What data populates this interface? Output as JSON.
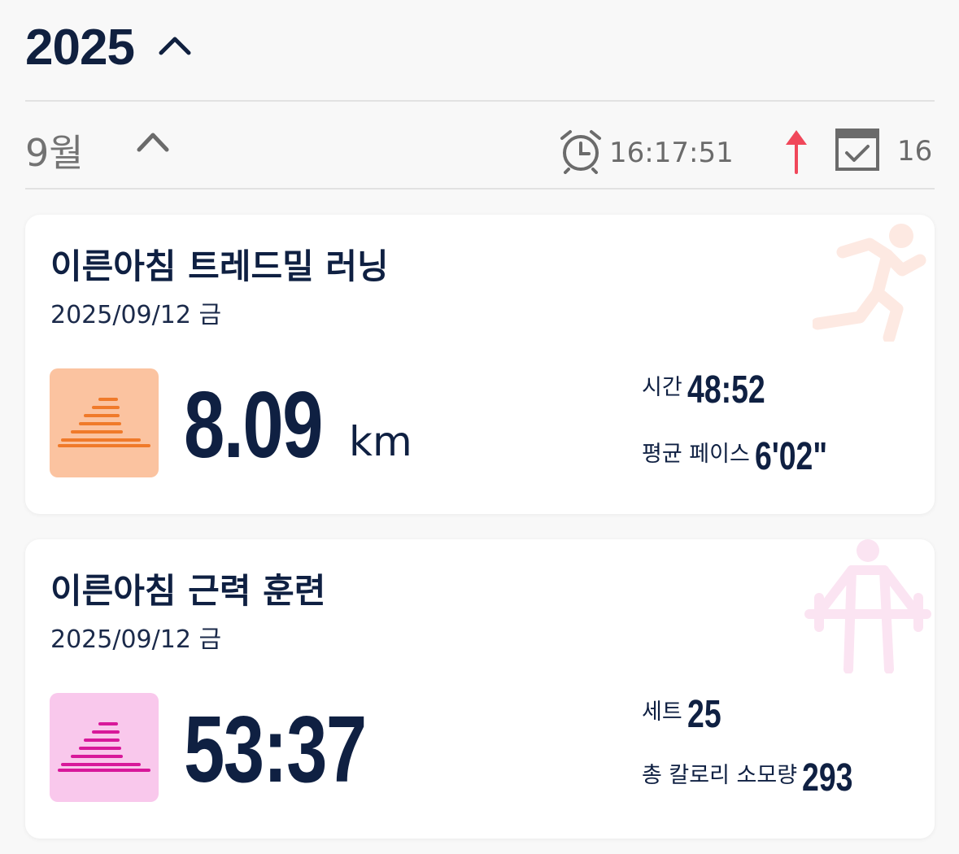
{
  "year": {
    "label": "2025"
  },
  "month": {
    "label": "9월",
    "time_total": "16:17:51",
    "days": "16",
    "colors": {
      "trend_up": "#f0475a",
      "icon_gray": "#6b6b6b"
    }
  },
  "activities": [
    {
      "title": "이른아침 트레드밀 러닝",
      "date": "2025/09/12 금",
      "main_value": "8.09",
      "main_unit": "km",
      "stats": [
        {
          "label": "시간",
          "value": "48:52"
        },
        {
          "label": "평균 페이스",
          "value": "6'02\""
        }
      ],
      "icon": "running-figure-icon",
      "accent": "#f07a2a",
      "thumb_bg": "#fbc3a0"
    },
    {
      "title": "이른아침 근력 훈련",
      "date": "2025/09/12 금",
      "main_value": "53:37",
      "main_unit": "",
      "stats": [
        {
          "label": "세트",
          "value": "25"
        },
        {
          "label": "총 칼로리 소모량",
          "value": "293"
        }
      ],
      "icon": "weightlifting-figure-icon",
      "accent": "#d8189a",
      "thumb_bg": "#f9c8ec"
    }
  ]
}
